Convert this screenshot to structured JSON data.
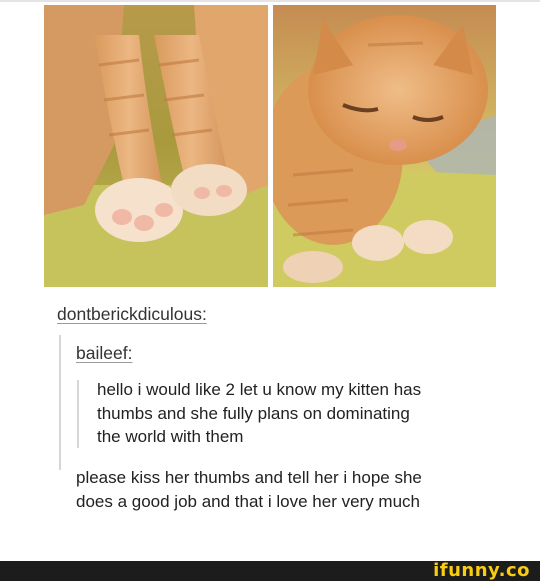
{
  "post": {
    "images": [
      {
        "alt": "kitten paws close-up"
      },
      {
        "alt": "orange kitten sitting"
      }
    ],
    "reblogger": "dontberickdiculous:",
    "original_poster": "baileef:",
    "original_lines": [
      "hello i would like 2 let u know my kitten has",
      "thumbs and she fully plans on dominating",
      "the world with them"
    ],
    "reply_lines": [
      "please kiss her thumbs and tell her i hope she",
      "does a good job and that i love her very much"
    ]
  },
  "footer": {
    "brand": "ifunny.co"
  },
  "colors": {
    "brand_yellow": "#f8cd12",
    "footer_bg": "#1c1c1c",
    "text": "#222222",
    "quote_bar": "#d6d6d6"
  },
  "icons": [
    "kitten-paws-photo",
    "kitten-photo"
  ]
}
